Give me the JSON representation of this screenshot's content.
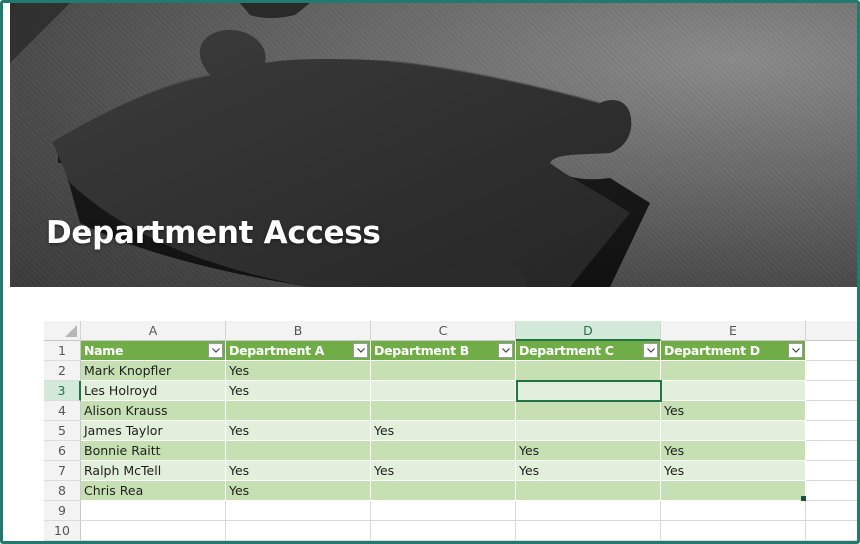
{
  "banner": {
    "title": "Department Access"
  },
  "sheet": {
    "columns": [
      "A",
      "B",
      "C",
      "D",
      "E"
    ],
    "rows": [
      "1",
      "2",
      "3",
      "4",
      "5",
      "6",
      "7",
      "8",
      "9",
      "10"
    ],
    "selected_column": "D",
    "selected_row": "3",
    "headers": [
      "Name",
      "Department A",
      "Department B",
      "Department C",
      "Department D"
    ],
    "data": [
      [
        "Mark Knopfler",
        "Yes",
        "",
        "",
        ""
      ],
      [
        "Les Holroyd",
        "Yes",
        "",
        "",
        ""
      ],
      [
        "Alison Krauss",
        "",
        "",
        "",
        "Yes"
      ],
      [
        "James Taylor",
        "Yes",
        "Yes",
        "",
        ""
      ],
      [
        "Bonnie Raitt",
        "",
        "",
        "Yes",
        "Yes"
      ],
      [
        "Ralph McTell",
        "Yes",
        "Yes",
        "Yes",
        "Yes"
      ],
      [
        "Chris Rea",
        "Yes",
        "",
        "",
        ""
      ]
    ]
  },
  "colors": {
    "frame": "#217a6e",
    "table_header": "#70ad47",
    "band_dark": "#c6e0b4",
    "band_light": "#e2efda",
    "selection": "#217346"
  },
  "icons": {
    "filter": "filter-dropdown-icon",
    "select_all": "select-all-triangle-icon"
  }
}
